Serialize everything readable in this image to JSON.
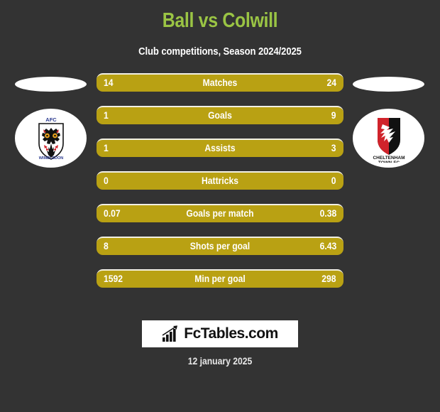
{
  "header": {
    "title": "Ball vs Colwill",
    "subtitle": "Club competitions, Season 2024/2025"
  },
  "colors": {
    "background": "#333333",
    "title": "#9ac444",
    "bar": "#b9a113",
    "bar_highlight": "#f2f0e4",
    "text": "#ffffff"
  },
  "teams": {
    "home": {
      "crest_name": "afc-wimbledon-crest",
      "crest_text_top": "AFC",
      "crest_text_bottom": "WIMBLEDON"
    },
    "away": {
      "crest_name": "cheltenham-town-crest",
      "crest_text_line1": "CHELTENHAM",
      "crest_text_line2": "TOWN FC"
    }
  },
  "stats": [
    {
      "label": "Matches",
      "home": "14",
      "away": "24"
    },
    {
      "label": "Goals",
      "home": "1",
      "away": "9"
    },
    {
      "label": "Assists",
      "home": "1",
      "away": "3"
    },
    {
      "label": "Hattricks",
      "home": "0",
      "away": "0"
    },
    {
      "label": "Goals per match",
      "home": "0.07",
      "away": "0.38"
    },
    {
      "label": "Shots per goal",
      "home": "8",
      "away": "6.43"
    },
    {
      "label": "Min per goal",
      "home": "1592",
      "away": "298"
    }
  ],
  "footer": {
    "brand": "FcTables.com",
    "brand_icon": "bar-chart-icon",
    "date": "12 january 2025"
  }
}
